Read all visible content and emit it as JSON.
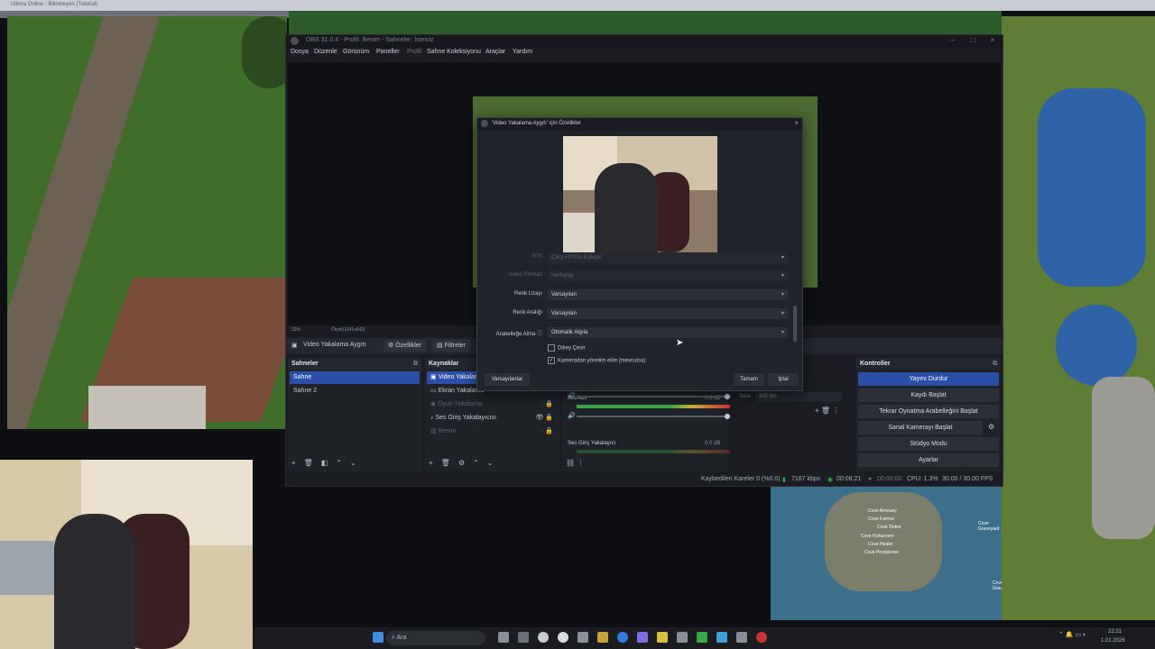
{
  "top_window_title": "Ultima Online - Bilinmeyen (Tutorial)",
  "obs": {
    "title": "OBS 31.0.4 - Profil: Benim - Sahneler: İsimsiz",
    "menu": [
      "Dosya",
      "Düzenle",
      "Görünüm",
      "Paneller",
      "Profil",
      "Sahne Koleksiyonu",
      "Araçlar",
      "Yardım"
    ],
    "preview_bar": {
      "zoom": "33%",
      "resolution": "Ölçek(1141x642)"
    },
    "source_toolbar": {
      "source_name": "Video Yakalama Aygıtı",
      "properties_button": "Özellikler",
      "filters_button": "Filtreler"
    },
    "scenes": {
      "header": "Sahneler",
      "items": [
        "Sahne",
        "Sahne 2"
      ],
      "selected": 0
    },
    "sources": {
      "header": "Kaynaklar",
      "items": [
        {
          "name": "Video Yakalama...",
          "icon": "camera-icon",
          "selected": true,
          "muted": false
        },
        {
          "name": "Ekran Yakalama",
          "icon": "monitor-icon",
          "selected": false,
          "muted": false
        },
        {
          "name": "Oyun Yakalama",
          "icon": "gamepad-icon",
          "selected": false,
          "muted": true
        },
        {
          "name": "Ses Giriş Yakalayıcısı",
          "icon": "microphone-icon",
          "selected": false,
          "muted": false
        },
        {
          "name": "Resim",
          "icon": "image-icon",
          "selected": false,
          "muted": true
        }
      ]
    },
    "mixer": [
      {
        "name": "Mic/Aux",
        "db": "0.0 dB",
        "level": 0.7
      },
      {
        "name": "Ses Giriş Yakalayıcı",
        "db": "0.0 dB",
        "level": 0.45
      }
    ],
    "transition": {
      "duration_label": "Süre",
      "duration_value": "300 ms"
    },
    "controls": {
      "header": "Kontroller",
      "buttons": [
        "Yayını Durdur",
        "Kaydı Başlat",
        "Tekrar Oynatma Arabelleğini Başlat",
        "Sanal Kamerayı Başlat",
        "Stüdyo Modu",
        "Ayarlar"
      ]
    },
    "status": {
      "dropped_frames": "Kaybedilen Kareler 0 (%0.0)",
      "bitrate": "7167 kbps",
      "stream_time": "00:08:21",
      "rec_time": "00:00:00",
      "cpu": "CPU: 1.3%",
      "fps": "30.00 / 30.00 FPS"
    }
  },
  "properties_dialog": {
    "title": "'Video Yakalama Aygıtı' için Özellikler",
    "rows": [
      {
        "label": "FPS",
        "value": "Çıkış FPS'ini Eşleştir",
        "dim": true
      },
      {
        "label": "Video Formatı",
        "value": "Herhangi",
        "dim": true
      },
      {
        "label": "Renk Uzayı",
        "value": "Varsayılan",
        "dim": false
      },
      {
        "label": "Renk Aralığı",
        "value": "Varsayılan",
        "dim": false
      },
      {
        "label": "Arabelleğe Alma",
        "value": "Otomatik Algıla",
        "dim": false
      }
    ],
    "checks": [
      {
        "label": "Dikey Çevir",
        "checked": false
      },
      {
        "label": "Kameradan yönelim ekle (mevcutsa)",
        "checked": true
      }
    ],
    "defaults_button": "Varsayılanlar",
    "ok_button": "Tamam",
    "cancel_button": "İptal"
  },
  "taskbar": {
    "search_placeholder": "Ara",
    "time": "22:21",
    "date": "1.01.2026"
  },
  "map_labels": [
    "Cove Armoury",
    "Cove Farmer",
    "Cove Tinker",
    "Cove Fishermen",
    "Cove Healer",
    "Cove Provisioner",
    "Cove Graveyard",
    "Cove Graveyard"
  ]
}
